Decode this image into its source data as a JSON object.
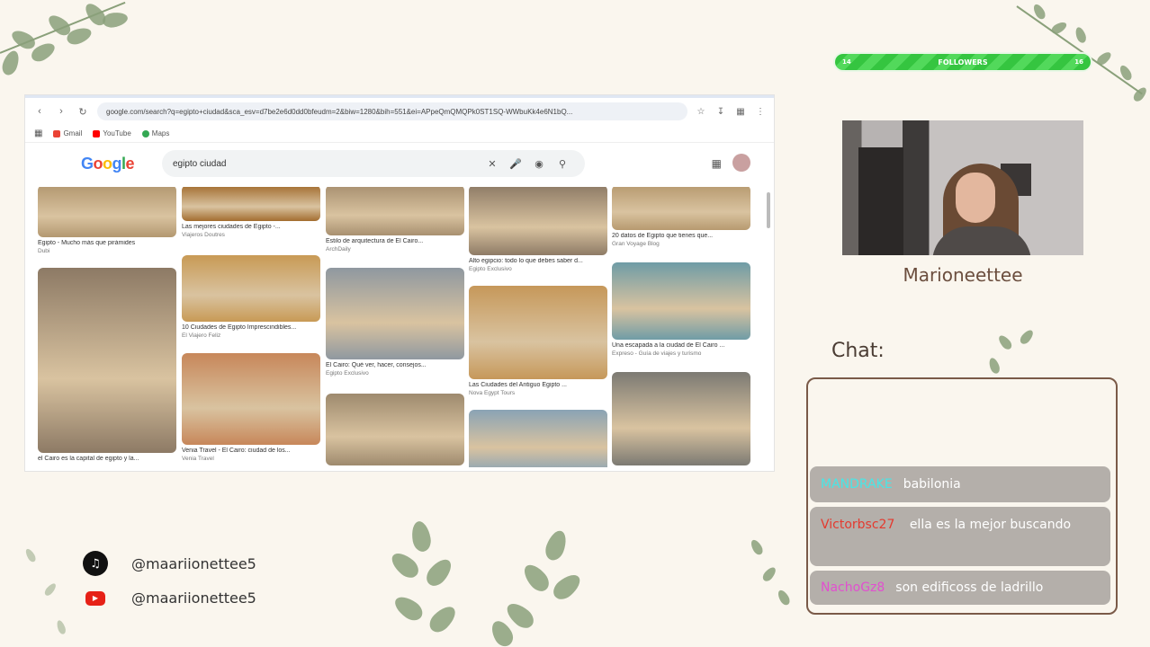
{
  "browser": {
    "url": "google.com/search?q=egipto+ciudad&sca_esv=d7be2e6d0dd0bfeudm=2&biw=1280&bih=551&ei=APpeQmQMQPk0ST1SQ-WWbuKk4e6N1bQ...",
    "bookmarks": [
      "Gmail",
      "YouTube",
      "Maps"
    ],
    "logo": "Google",
    "search_query": "egipto ciudad"
  },
  "results": [
    {
      "caption": "Egipto - Mucho más que pirámides",
      "source": "Dubi",
      "color": "#b39870",
      "height": 58
    },
    {
      "caption": "Las mejores ciudades de Egipto -...",
      "source": "Viajeros Doutres",
      "color": "#a36d2f",
      "height": 40
    },
    {
      "caption": "Estilo de arquitectura de El Cairo...",
      "source": "ArchDaily",
      "color": "#a89070",
      "height": 56
    },
    {
      "caption": "Alto egipcio: todo lo que debes saber d...",
      "source": "Egipto Exclusivo",
      "color": "#8e7b66",
      "height": 78
    },
    {
      "caption": "20 datos de Egipto que tienes que...",
      "source": "Gran Voyage Blog",
      "color": "#b79a70",
      "height": 50
    },
    {
      "caption": "el Cairo es la capital de egipto y la...",
      "source": "",
      "color": "#8d7a65",
      "height": 206
    },
    {
      "caption": "10 Ciudades de Egipto Imprescindibles...",
      "source": "El Viajero Feliz",
      "color": "#c89a55",
      "height": 74
    },
    {
      "caption": "El Cairo: Qué ver, hacer, consejos...",
      "source": "Egipto Exclusivo",
      "color": "#8f98a0",
      "height": 102
    },
    {
      "caption": "Las Ciudades del Antiguo Egipto ...",
      "source": "Nova Egypt Tours",
      "color": "#c6985a",
      "height": 104
    },
    {
      "caption": "Una escapada a la ciudad de El Cairo ...",
      "source": "Expreso - Guía de viajes y turismo",
      "color": "#6f9ca6",
      "height": 86
    },
    {
      "caption": "Venia Travel - El Cairo: ciudad de los...",
      "source": "Venia Travel",
      "color": "#c7875a",
      "height": 102
    },
    {
      "caption": "",
      "source": "",
      "color": "#9e8a6e",
      "height": 80
    },
    {
      "caption": "",
      "source": "",
      "color": "#8aa3b5",
      "height": 70
    },
    {
      "caption": "",
      "source": "",
      "color": "#7c7a73",
      "height": 104
    }
  ],
  "followers": {
    "label": "FOLLOWERS",
    "current": "14",
    "goal": "16",
    "progress": 0.875
  },
  "streamer": {
    "name": "Marioneettee"
  },
  "chat": {
    "title": "Chat:",
    "messages": [
      {
        "user": "MANDRAKE",
        "color": "#48e6e6",
        "text": "babilonia"
      },
      {
        "user": "Victorbsc27",
        "color": "#e43a2f",
        "text": "ella es la mejor buscando"
      },
      {
        "user": "NachoGz8",
        "color": "#e24fd0",
        "text": "son edificoss de ladrillo"
      }
    ]
  },
  "socials": {
    "tiktok_handle": "@maariionettee5",
    "youtube_handle": "@maariionettee5"
  }
}
